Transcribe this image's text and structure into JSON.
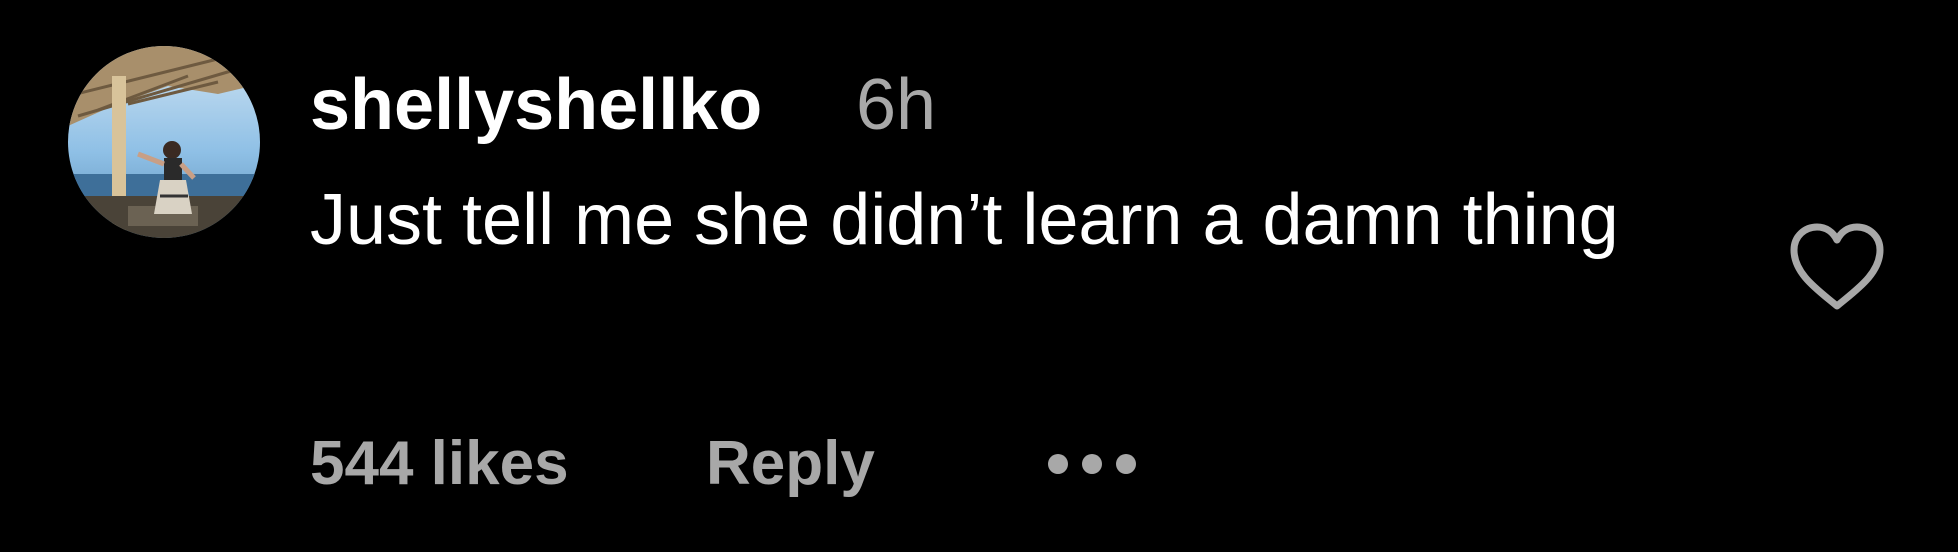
{
  "comment": {
    "username": "shellyshellko",
    "time": "6h",
    "text": "Just tell me she didn’t learn a damn thing",
    "likes_label": "544 likes",
    "reply_label": "Reply"
  },
  "icons": {
    "avatar": "profile-photo",
    "more": "more-horizontal-icon",
    "like": "heart-outline-icon"
  },
  "colors": {
    "background": "#000000",
    "primary_text": "#ffffff",
    "secondary_text": "#a8a8a8"
  }
}
